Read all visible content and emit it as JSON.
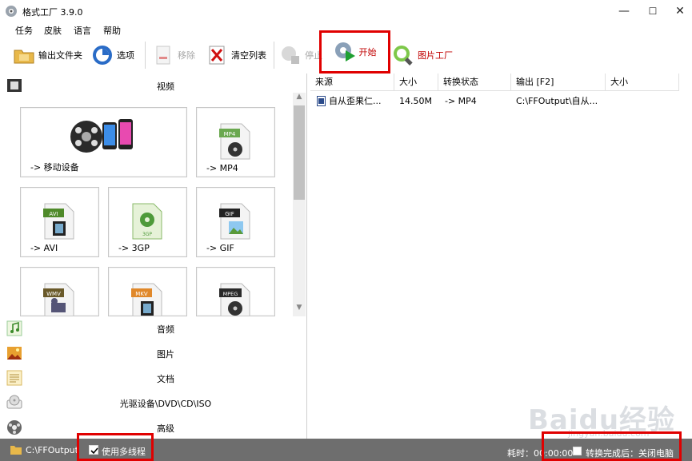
{
  "window": {
    "title": "格式工厂 3.9.0",
    "minimize": "—",
    "maximize": "☐",
    "close": "✕"
  },
  "menu": [
    "任务",
    "皮肤",
    "语言",
    "帮助"
  ],
  "toolbar": {
    "output_folder": "输出文件夹",
    "options": "选项",
    "remove": "移除",
    "clear_list": "清空列表",
    "stop": "停止",
    "start": "开始",
    "picture_factory": "图片工厂"
  },
  "categories": {
    "video": "视频",
    "audio": "音频",
    "picture": "图片",
    "document": "文档",
    "rom": "光驱设备\\DVD\\CD\\ISO",
    "advanced": "高级"
  },
  "tiles": {
    "mobile": "-> 移动设备",
    "mp4": "-> MP4",
    "avi": "-> AVI",
    "3gp": "-> 3GP",
    "gif": "-> GIF",
    "mp4_badge": "MP4",
    "avi_badge": "AVI",
    "3gp_badge": "3GP",
    "gif_badge": "GIF",
    "wmv_badge": "WMV",
    "mkv_badge": "MKV",
    "mpeg_badge": "MPEG"
  },
  "columns": [
    "来源",
    "大小",
    "转换状态",
    "输出 [F2]",
    "大小"
  ],
  "rows": [
    {
      "source": "自从歪果仁...",
      "size": "14.50M",
      "status": "-> MP4",
      "output": "C:\\FFOutput\\自从...",
      "out_size": ""
    }
  ],
  "statusbar": {
    "path": "C:\\FFOutput",
    "multithread_label": "使用多线程",
    "elapsed": "耗时：00:00:00",
    "after_convert": "转换完成后：关闭电脑"
  },
  "watermark": {
    "brand": "Baidu经验",
    "url": "jingyan.baidu.com"
  },
  "colors": {
    "highlight": "#e00000",
    "statusbar": "#6e6e6e",
    "start_text": "#c00000"
  }
}
